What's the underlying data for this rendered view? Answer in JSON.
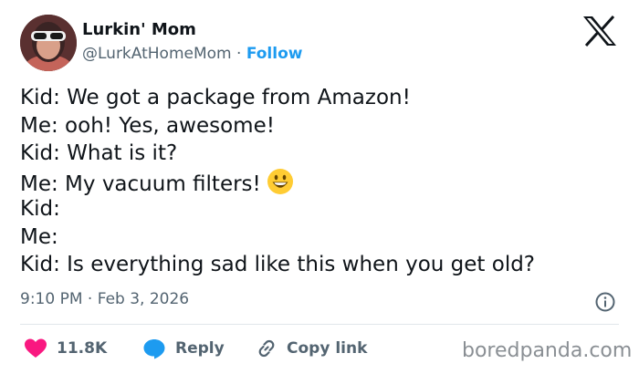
{
  "author": {
    "display_name": "Lurkin' Mom",
    "handle": "@LurkAtHomeMom",
    "separator": "·",
    "follow_label": "Follow"
  },
  "tweet": {
    "lines": [
      "Kid: We got a package from Amazon!",
      "Me: ooh! Yes, awesome!",
      "Kid: What is it?",
      "Me: My vacuum filters!",
      "Kid:",
      "Me:",
      "Kid: Is everything sad like this when you get old?"
    ],
    "emoji_icon": "grinning-face-emoji"
  },
  "meta": {
    "time": "9:10 PM",
    "separator": "·",
    "date": "Feb 3, 2026"
  },
  "actions": {
    "like_count": "11.8K",
    "reply_label": "Reply",
    "copy_link_label": "Copy link"
  },
  "watermark": "boredpanda.com",
  "colors": {
    "accent": "#1d9bf0",
    "like": "#f91880",
    "text": "#0f1419",
    "muted": "#536471"
  }
}
